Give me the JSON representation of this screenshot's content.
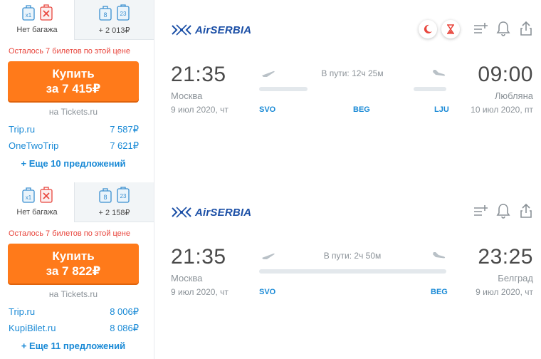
{
  "results": [
    {
      "baggage": {
        "no_bag": {
          "badge": "x1",
          "label": "Нет багажа"
        },
        "with_bag": {
          "badge_a": "8",
          "badge_b": "23",
          "label": "+ 2 013₽"
        }
      },
      "warning": "Осталось 7 билетов по этой цене",
      "buy": {
        "line1": "Купить",
        "line2": "за 7 415₽"
      },
      "on_site": "на Tickets.ru",
      "offers": [
        {
          "agent": "Trip.ru",
          "price": "7 587₽"
        },
        {
          "agent": "OneTwoTrip",
          "price": "7 621₽"
        }
      ],
      "more": "+ Еще 10 предложений",
      "airline": "AirSERBIA",
      "badges": [
        "night-icon",
        "hourglass-icon"
      ],
      "departure": {
        "time": "21:35",
        "city": "Москва",
        "date": "9 июл 2020, чт",
        "iata": "SVO"
      },
      "arrival": {
        "time": "09:00",
        "city": "Любляна",
        "date": "10 июл 2020, пт",
        "iata": "LJU"
      },
      "stop_iata": "BEG",
      "duration": "В пути: 12ч 25м"
    },
    {
      "baggage": {
        "no_bag": {
          "badge": "x1",
          "label": "Нет багажа"
        },
        "with_bag": {
          "badge_a": "8",
          "badge_b": "23",
          "label": "+ 2 158₽"
        }
      },
      "warning": "Осталось 7 билетов по этой цене",
      "buy": {
        "line1": "Купить",
        "line2": "за 7 822₽"
      },
      "on_site": "на Tickets.ru",
      "offers": [
        {
          "agent": "Trip.ru",
          "price": "8 006₽"
        },
        {
          "agent": "KupiBilet.ru",
          "price": "8 086₽"
        }
      ],
      "more": "+ Еще 11 предложений",
      "airline": "AirSERBIA",
      "badges": [],
      "departure": {
        "time": "21:35",
        "city": "Москва",
        "date": "9 июл 2020, чт",
        "iata": "SVO"
      },
      "arrival": {
        "time": "23:25",
        "city": "Белград",
        "date": "9 июл 2020, чт",
        "iata": "BEG"
      },
      "duration": "В пути: 2ч 50м"
    }
  ],
  "colors": {
    "buy": "#ff7a1a",
    "link": "#1a8ad6",
    "warning": "#e8453c",
    "brand": "#1b4fa6"
  }
}
